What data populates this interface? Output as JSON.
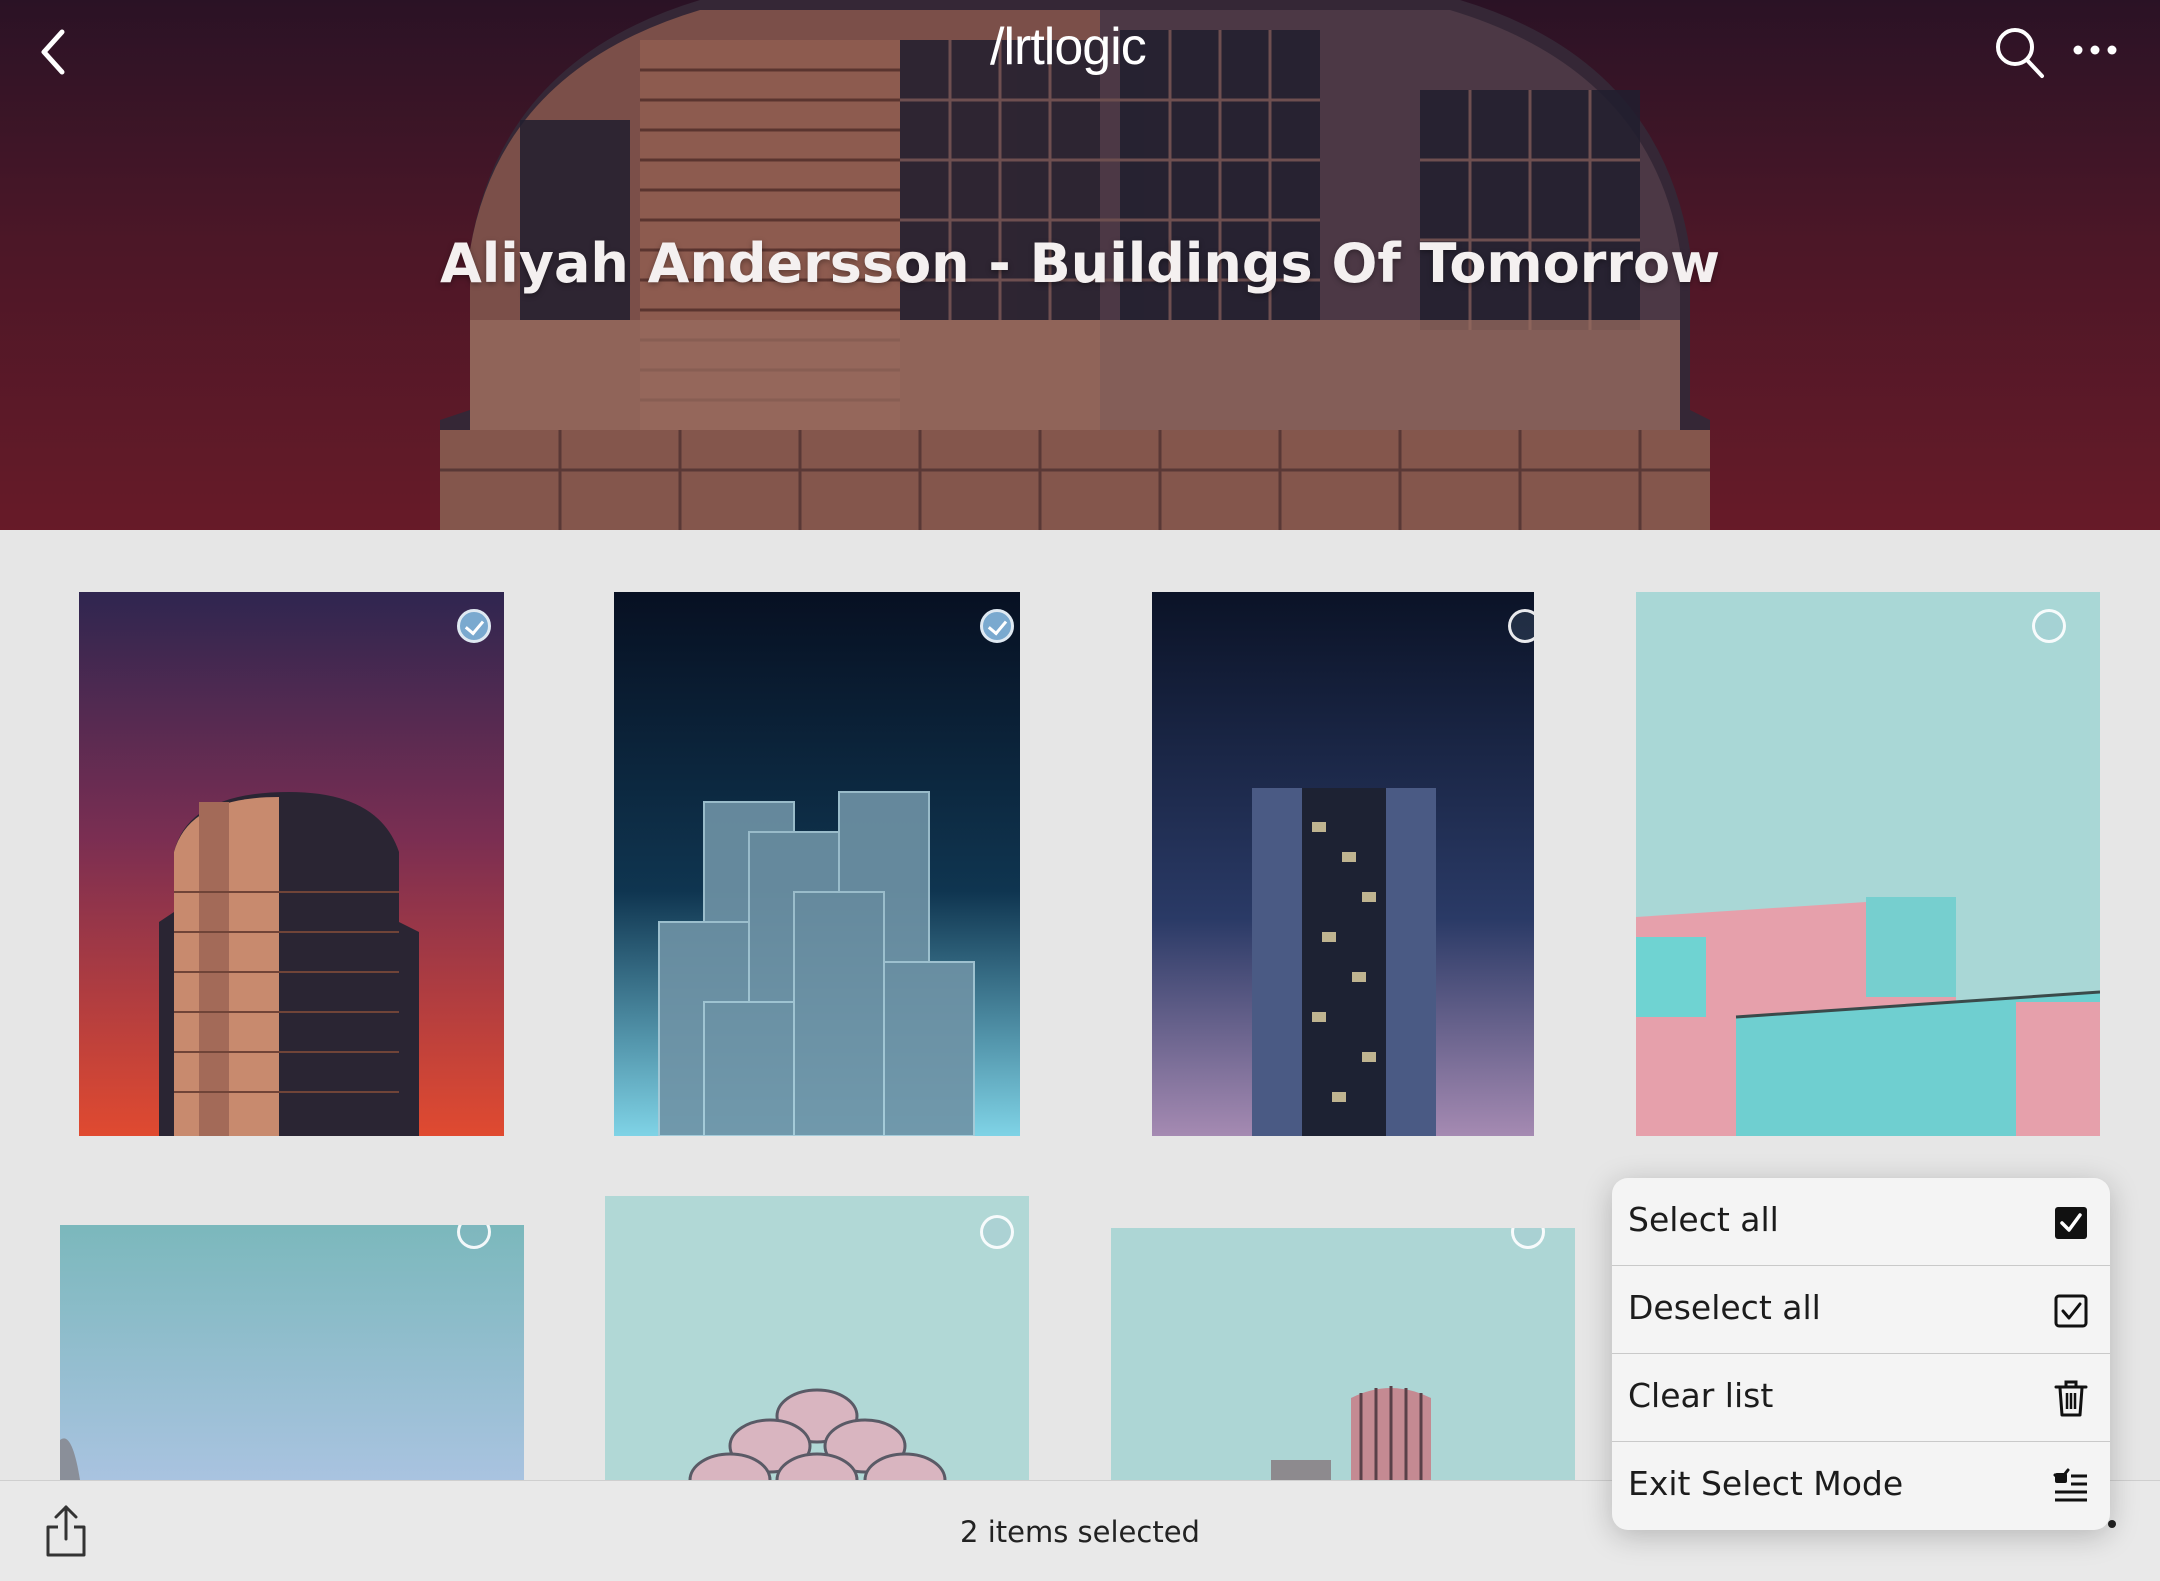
{
  "app": {
    "logo_text": "/lrtlogic"
  },
  "header": {
    "title": "Aliyah Andersson - Buildings Of Tomorrow"
  },
  "icons": {
    "back": "chevron-left-icon",
    "search": "search-icon",
    "more": "more-horizontal-icon",
    "share": "share-icon"
  },
  "grid": {
    "items": [
      {
        "selected": true
      },
      {
        "selected": true
      },
      {
        "selected": false
      },
      {
        "selected": false
      },
      {
        "selected": false
      },
      {
        "selected": false
      },
      {
        "selected": false
      }
    ]
  },
  "bottom_bar": {
    "status": "2 items selected"
  },
  "menu": {
    "items": [
      {
        "label": "Select all",
        "icon": "checkbox-filled-icon"
      },
      {
        "label": "Deselect all",
        "icon": "checkbox-outline-icon"
      },
      {
        "label": "Clear list",
        "icon": "trash-icon"
      },
      {
        "label": "Exit Select Mode",
        "icon": "checklist-icon"
      }
    ]
  },
  "colors": {
    "header_gradient_top": "#2c1629",
    "header_gradient_bottom": "#80212d",
    "selected_badge": "#7aa9cf",
    "page_background": "#e6e6e6"
  }
}
